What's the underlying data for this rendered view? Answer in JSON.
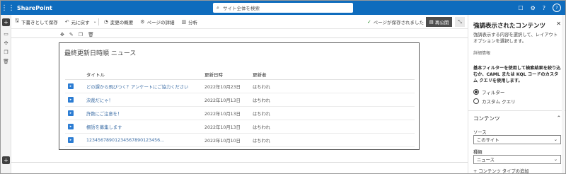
{
  "suitebar": {
    "app_name": "SharePoint",
    "search_placeholder": "サイト全体を検索",
    "avatar_initial": "?"
  },
  "cmdbar": {
    "save_draft": "下書きとして保存",
    "undo": "元に戻す",
    "changes": "変更の概要",
    "page_details": "ページの詳細",
    "analytics": "分析",
    "saved_status": "ページが保存されました",
    "republish": "再公開"
  },
  "webpart": {
    "title": "最終更新日時順 ニュース",
    "columns": {
      "title": "タイトル",
      "date": "更新日時",
      "author": "更新者"
    },
    "rows": [
      {
        "title": "どの課から飛びつく？アンケートにご協力ください",
        "date": "2022年10月23日",
        "author": "はちわれ"
      },
      {
        "title": "決裁だにゃ！",
        "date": "2022年10月13日",
        "author": "はちわれ"
      },
      {
        "title": "許数にご注意を！",
        "date": "2022年10月13日",
        "author": "はちわれ"
      },
      {
        "title": "棚語を募集します",
        "date": "2022年10月13日",
        "author": "はちわれ"
      },
      {
        "title": "12345678901234567890123456...",
        "date": "2022年10月10日",
        "author": "はちわれ"
      }
    ]
  },
  "pane": {
    "title": "強調表示されたコンテンツ",
    "description": "強調表示する内容を選択して、レイアウト オプションを選択します。",
    "details_link": "詳細情報",
    "filter_text": "基本フィルターを使用して検索結果を絞り込むか、CAML または KQL コードのカスタム クエリを使用します。",
    "radio_filter": "フィルター",
    "radio_custom": "カスタム クエリ",
    "section_content": "コンテンツ",
    "source_label": "ソース",
    "source_value": "このサイト",
    "type_label": "種類",
    "type_value": "ニュース",
    "add_content_type": "コンテンツ タイプの追加"
  },
  "colors": {
    "suitebar": "#0f6cbd",
    "link": "#3d6ea6",
    "republish_bg": "#4d4d4d"
  }
}
